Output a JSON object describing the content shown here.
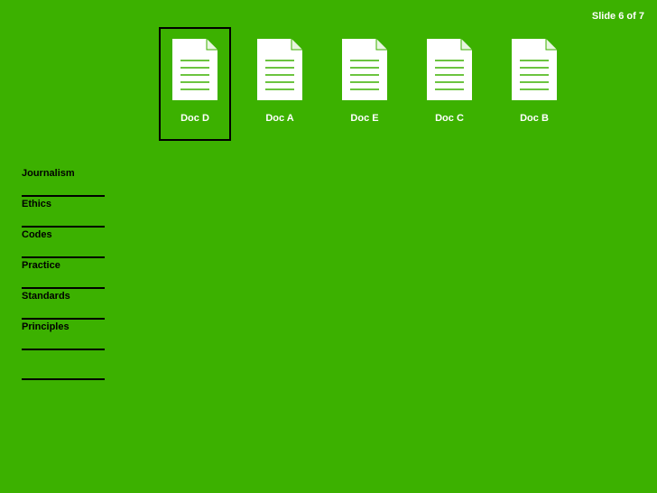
{
  "slide_counter": {
    "prefix": "Slide",
    "current": "6",
    "of": "of",
    "total": "7"
  },
  "documents": [
    {
      "label": "Doc D",
      "icon": "document-icon",
      "selected": true
    },
    {
      "label": "Doc A",
      "icon": "document-icon",
      "selected": false
    },
    {
      "label": "Doc E",
      "icon": "document-icon",
      "selected": false
    },
    {
      "label": "Doc C",
      "icon": "document-icon",
      "selected": false
    },
    {
      "label": "Doc B",
      "icon": "document-icon",
      "selected": false
    }
  ],
  "sidebar": {
    "items": [
      {
        "label": "Journalism"
      },
      {
        "label": "Ethics"
      },
      {
        "label": "Codes"
      },
      {
        "label": "Practice"
      },
      {
        "label": "Standards"
      },
      {
        "label": "Principles"
      },
      {
        "label": ""
      }
    ]
  },
  "colors": {
    "background": "#3cb100",
    "selection_border": "#000000",
    "doc_lines": "#3cb100"
  }
}
